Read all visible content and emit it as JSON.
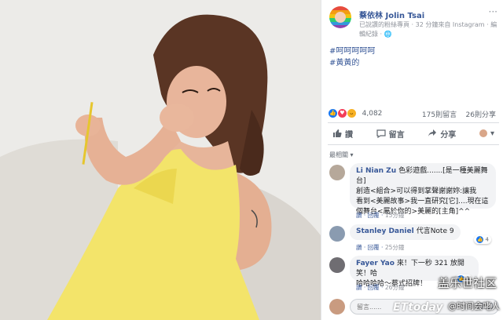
{
  "post": {
    "page_name": "蔡依林 Jolin Tsai",
    "meta_line1": "已說讚的粉絲專頁 · 32 分鐘來自 Instagram · 編",
    "meta_line2": "輯紀錄 · 🌐",
    "more_icon": "more-dots-icon",
    "hashtags": [
      "#呵呵呵呵呵",
      "#黃黃的"
    ]
  },
  "reactions": {
    "count": "4,082",
    "comments": "175則留言",
    "shares": "26則分享",
    "icons": [
      "like-icon",
      "love-icon",
      "haha-icon"
    ],
    "colors": {
      "like": "#1877f2",
      "love": "#f33e58",
      "haha": "#f7b125"
    }
  },
  "actions": {
    "like": "讚",
    "comment": "留言",
    "share": "分享"
  },
  "sort_label": "最相關 ▾",
  "comments": [
    {
      "name": "Li Nian Zu",
      "text_lines": [
        "色彩遊戲.......[是一種美麗舞台]",
        "創造<組合>可以得到掌聲謝謝妳:讓我",
        "看到<美麗故事>我一直研究[它]....現在這",
        "個舞台<屬於你的>美麗的[主角]^^"
      ],
      "action_like": "讚",
      "action_reply": "回覆",
      "time": "15分鐘"
    },
    {
      "name": "Stanley Daniel",
      "text_lines": [
        "代言Note 9"
      ],
      "action_like": "讚",
      "action_reply": "回覆",
      "time": "25分鐘",
      "likes": "4"
    },
    {
      "name": "Fayer Yao",
      "text_lines": [
        "來！下一秒 321 放開笑！哈",
        "哈哈哈哈～蔡式招牌！"
      ],
      "action_like": "讚",
      "action_reply": "回覆",
      "time": "26分鐘",
      "likes": "1"
    }
  ],
  "comment_input": {
    "placeholder": "留言......"
  },
  "watermarks": {
    "site": "盖乐世社区",
    "account": "@时间会咾人",
    "brand": "ETtoday"
  },
  "colors": {
    "link": "#385898",
    "dress": "#f3e46a",
    "background": "#ececea"
  }
}
